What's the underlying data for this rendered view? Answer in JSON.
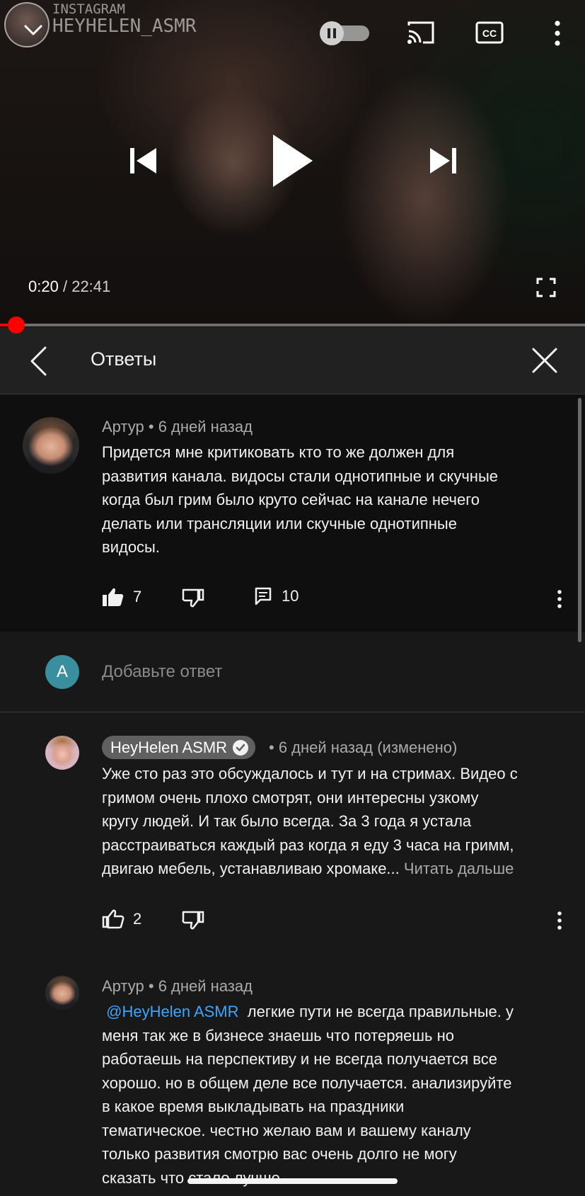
{
  "player": {
    "watermark_line1": "INSTAGRAM",
    "watermark_line2": "HEYHELEN_ASMR",
    "current_time": "0:20",
    "separator": "/",
    "duration": "22:41",
    "progress": 0.015,
    "icons": [
      "chevron-down-icon",
      "autoplay-toggle-icon",
      "cast-icon",
      "captions-icon",
      "more-vert-icon",
      "previous-icon",
      "play-icon",
      "next-icon",
      "fullscreen-icon"
    ]
  },
  "replies_panel": {
    "title": "Ответы"
  },
  "parent_comment": {
    "author": "Артур",
    "dot": "•",
    "time": "6 дней назад",
    "text_lines": [
      "Придется мне критиковать кто то же должен для",
      "развития канала. видосы стали однотипные и скучные",
      "когда был грим было круто сейчас на канале нечего",
      "делать или трансляции или скучные однотипные",
      "видосы."
    ],
    "likes": "7",
    "replies": "10"
  },
  "reply_input": {
    "avatar_letter": "A",
    "placeholder": "Добавьте ответ"
  },
  "replies": [
    {
      "author": "HeyHelen ASMR",
      "dot": "•",
      "time": "6 дней назад (изменено)",
      "text_lines": [
        "Уже сто раз это обсуждалось и тут и на стримах. Видео с",
        "гримом очень плохо смотрят, они интересны узкому",
        "кругу людей. И так было всегда. За 3 года я устала",
        "расстраиваться каждый раз когда я еду 3 часа на гримм,",
        "двигаю мебель, устанавливаю хромаке..."
      ],
      "read_more": "Читать дальше",
      "likes": "2"
    },
    {
      "author": "Артур",
      "dot": "•",
      "time": "6 дней назад",
      "mention": "@HeyHelen ASMR",
      "first_line_rest": "легкие пути не всегда правильные. у",
      "text_lines": [
        "меня так же в бизнесе знаешь что потеряешь но",
        "работаешь на перспективу и не всегда получается все",
        "хорошо. но в общем деле все получается. анализируйте",
        "в какое время выкладывать на праздники",
        "тематическое. честно желаю вам и вашему каналу",
        "только развития смотрю вас очень долго не могу",
        "сказать что стало лучше"
      ]
    }
  ],
  "colors": {
    "background": "#181818",
    "header": "#212121",
    "parent_comment_bg": "#0f0f0f",
    "progress": "#ff0000",
    "mention": "#3ea6ff",
    "secondary_text": "#aaaaaa"
  }
}
